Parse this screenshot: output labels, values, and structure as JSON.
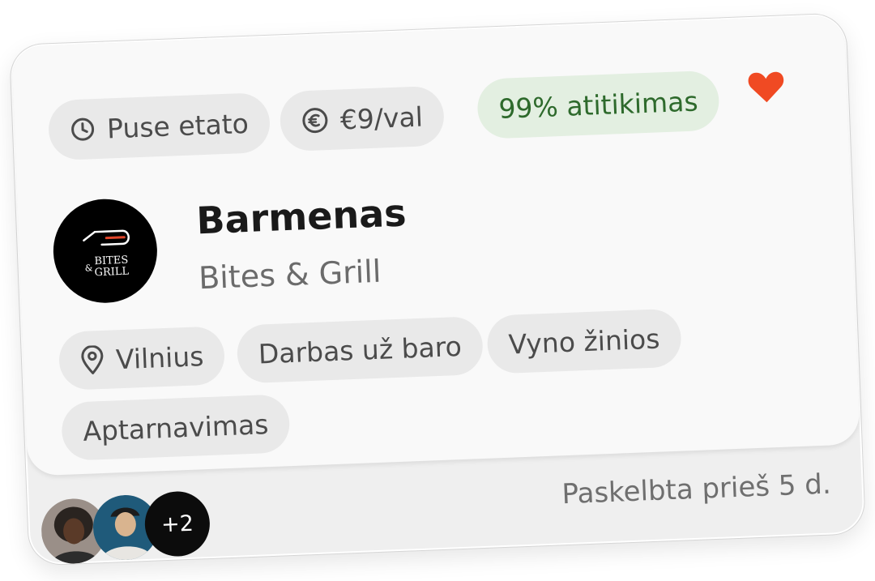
{
  "tags_top": {
    "schedule": "Puse etato",
    "rate": "€9/val",
    "match": "99% atitikimas"
  },
  "job": {
    "title": "Barmenas",
    "company": "Bites & Grill"
  },
  "logo": {
    "line1": "BITES",
    "amp": "&",
    "line2": "GRILL"
  },
  "tags": {
    "location": "Vilnius",
    "tag1": "Darbas už baro",
    "tag2": "Vyno žinios",
    "tag3": "Aptarnavimas"
  },
  "applicants": {
    "extra_count": "+2"
  },
  "posted": "Paskelbta prieš 5 d.",
  "colors": {
    "heart": "#f04a23",
    "match_bg": "#e3efe1",
    "match_text": "#2e6a2c",
    "pill_bg": "#e9e9e9"
  },
  "icons": {
    "schedule": "clock-icon",
    "rate": "euro-icon",
    "favorite": "heart-icon",
    "location": "location-pin-icon"
  }
}
